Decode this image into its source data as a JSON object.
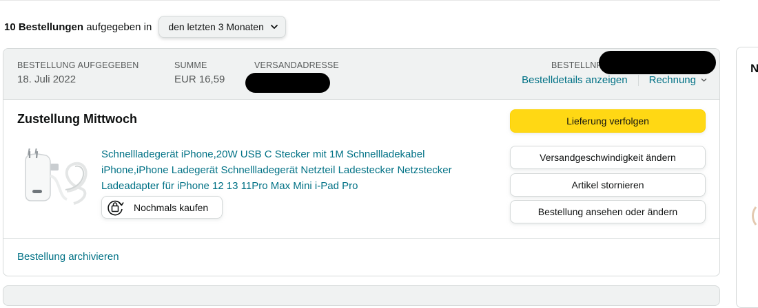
{
  "filter": {
    "count_bold": "10 Bestellungen",
    "count_rest": " aufgegeben in",
    "range_selected": "den letzten 3 Monaten"
  },
  "order": {
    "header": {
      "placed_label": "BESTELLUNG AUFGEGEBEN",
      "placed_value": "18. Juli 2022",
      "total_label": "SUMME",
      "total_value": "EUR 16,59",
      "address_label": "VERSANDADRESSE",
      "order_no_label": "BESTELLNR.",
      "details_link": "Bestelldetails anzeigen",
      "invoice_link": "Rechnung"
    },
    "delivery_status": "Zustellung Mittwoch",
    "product": {
      "title": "Schnellladegerät iPhone,20W USB C Stecker mit 1M Schnellladekabel iPhone,iPhone Ladegerät Schnellladegerät Netzteil Ladestecker Netzstecker Ladeadapter für iPhone 12 13 11Pro Max Mini i-Pad Pro",
      "image_icon": "usb-c-charger-with-cable",
      "buy_again": "Nochmals kaufen"
    },
    "actions": {
      "track": "Lieferung verfolgen",
      "change_speed": "Versandgeschwindigkeit ändern",
      "cancel": "Artikel stornieren",
      "view_edit": "Bestellung ansehen oder ändern"
    },
    "archive_link": "Bestellung archivieren"
  },
  "side_panel": {
    "heading_fragment": "N"
  },
  "colors": {
    "link": "#007185",
    "primary_button": "#ffd814",
    "header_bg": "#f0f2f2",
    "border": "#d5d9d9",
    "muted_text": "#565959"
  }
}
